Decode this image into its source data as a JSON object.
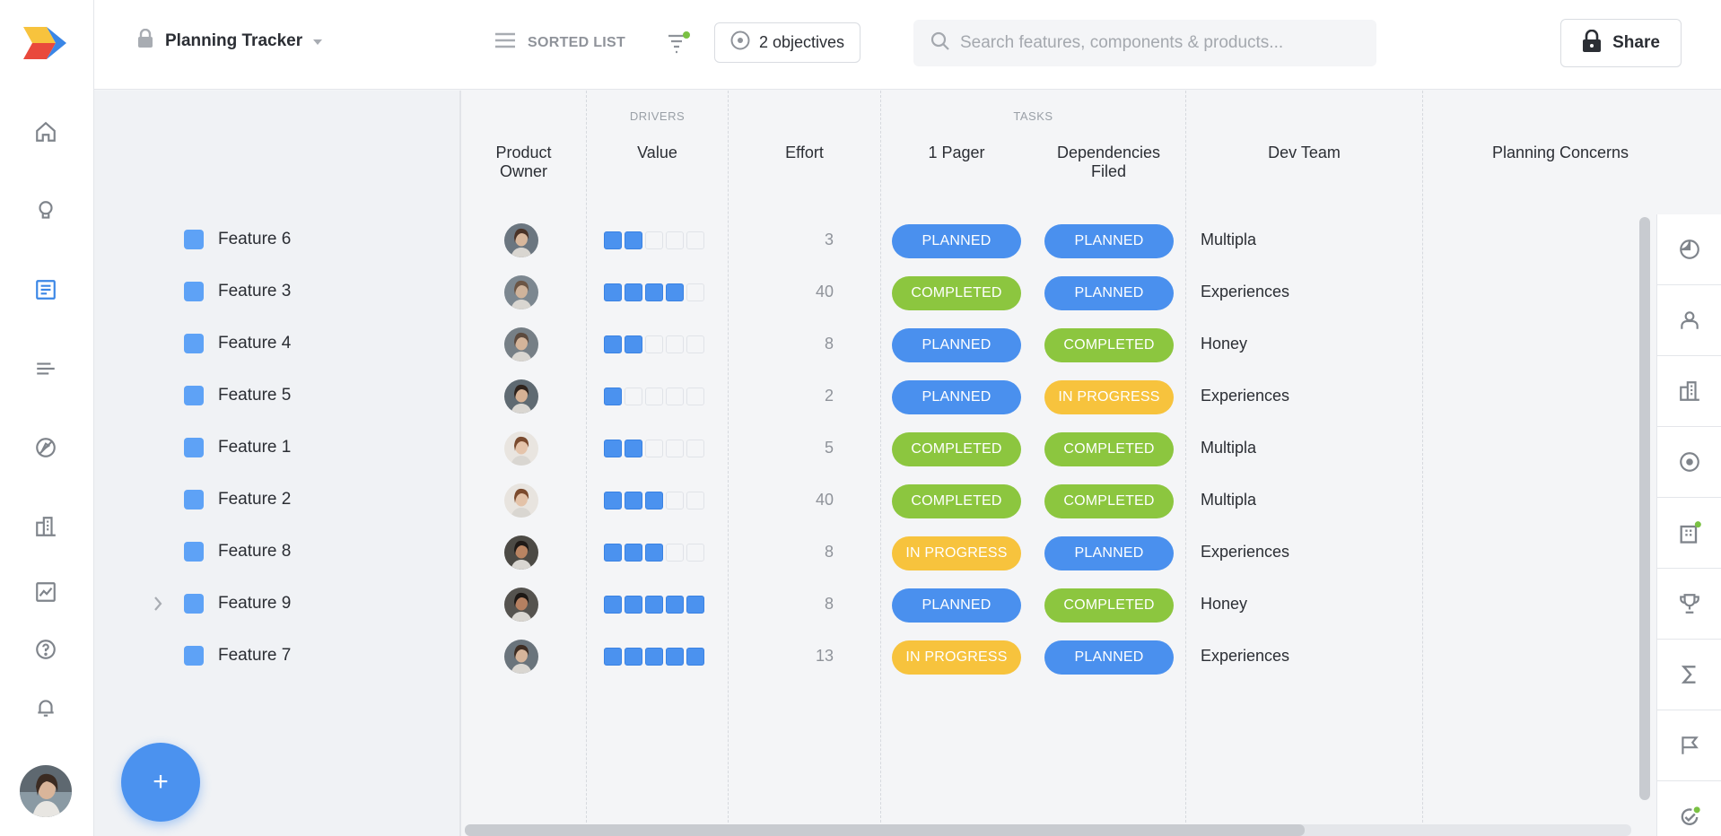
{
  "header": {
    "tracker_title": "Planning Tracker",
    "view_label": "SORTED LIST",
    "objectives_label": "2 objectives",
    "search_placeholder": "Search features, components & products...",
    "share_label": "Share"
  },
  "colors": {
    "accent": "#4b92ef",
    "planned": "#4a90ee",
    "completed": "#8cc63f",
    "in_progress": "#f7c33d",
    "feature_square": "#5ea2f6"
  },
  "nav": {
    "items": [
      "home-icon",
      "lightbulb-icon",
      "document-icon",
      "list-icon",
      "compass-icon",
      "buildings-icon",
      "chart-icon",
      "help-icon",
      "bell-icon"
    ],
    "active": "document-icon"
  },
  "columns": {
    "group_drivers": "DRIVERS",
    "group_tasks": "TASKS",
    "product_owner": "Product\nOwner",
    "value": "Value",
    "effort": "Effort",
    "one_pager": "1 Pager",
    "dependencies": "Dependencies\nFiled",
    "dev_team": "Dev Team",
    "planning_concerns": "Planning Concerns"
  },
  "rows": [
    {
      "name": "Feature 6",
      "value": 2,
      "effort": "3",
      "one_pager": "PLANNED",
      "dependencies": "PLANNED",
      "dev_team": "Multipla",
      "expandable": false
    },
    {
      "name": "Feature 3",
      "value": 4,
      "effort": "40",
      "one_pager": "COMPLETED",
      "dependencies": "PLANNED",
      "dev_team": "Experiences",
      "expandable": false
    },
    {
      "name": "Feature 4",
      "value": 2,
      "effort": "8",
      "one_pager": "PLANNED",
      "dependencies": "COMPLETED",
      "dev_team": "Honey",
      "expandable": false
    },
    {
      "name": "Feature 5",
      "value": 1,
      "effort": "2",
      "one_pager": "PLANNED",
      "dependencies": "IN PROGRESS",
      "dev_team": "Experiences",
      "expandable": false
    },
    {
      "name": "Feature 1",
      "value": 2,
      "effort": "5",
      "one_pager": "COMPLETED",
      "dependencies": "COMPLETED",
      "dev_team": "Multipla",
      "expandable": false
    },
    {
      "name": "Feature 2",
      "value": 3,
      "effort": "40",
      "one_pager": "COMPLETED",
      "dependencies": "COMPLETED",
      "dev_team": "Multipla",
      "expandable": false
    },
    {
      "name": "Feature 8",
      "value": 3,
      "effort": "8",
      "one_pager": "IN PROGRESS",
      "dependencies": "PLANNED",
      "dev_team": "Experiences",
      "expandable": false
    },
    {
      "name": "Feature 9",
      "value": 5,
      "effort": "8",
      "one_pager": "PLANNED",
      "dependencies": "COMPLETED",
      "dev_team": "Honey",
      "expandable": true
    },
    {
      "name": "Feature 7",
      "value": 5,
      "effort": "13",
      "one_pager": "IN PROGRESS",
      "dependencies": "PLANNED",
      "dev_team": "Experiences",
      "expandable": false
    }
  ],
  "value_max": 5,
  "right_rail": [
    "pie-chart-icon",
    "person-icon",
    "buildings-icon",
    "target-icon",
    "building-grid-icon",
    "trophy-icon",
    "sigma-icon",
    "flag-icon",
    "check-circle-icon"
  ],
  "fab_label": "+"
}
